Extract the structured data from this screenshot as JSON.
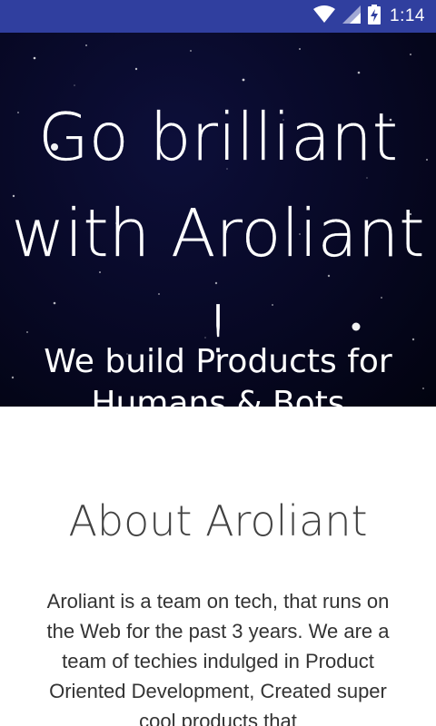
{
  "status_bar": {
    "time": "1:14",
    "icons": [
      "wifi-icon",
      "signal-icon",
      "battery-charging-icon"
    ]
  },
  "hero": {
    "title_line1": "Go brilliant",
    "title_line2": "with Aroliant !",
    "subtitle": "We build Products for Humans & Bots"
  },
  "about": {
    "title": "About Aroliant",
    "description": "Aroliant is a team on tech, that runs on the Web for the past 3 years. We are a team of techies indulged in Product Oriented Development, Created super cool products that"
  },
  "colors": {
    "status_bar": "#303f9f",
    "hero_bg": "#070824",
    "text_dark": "#333333"
  }
}
